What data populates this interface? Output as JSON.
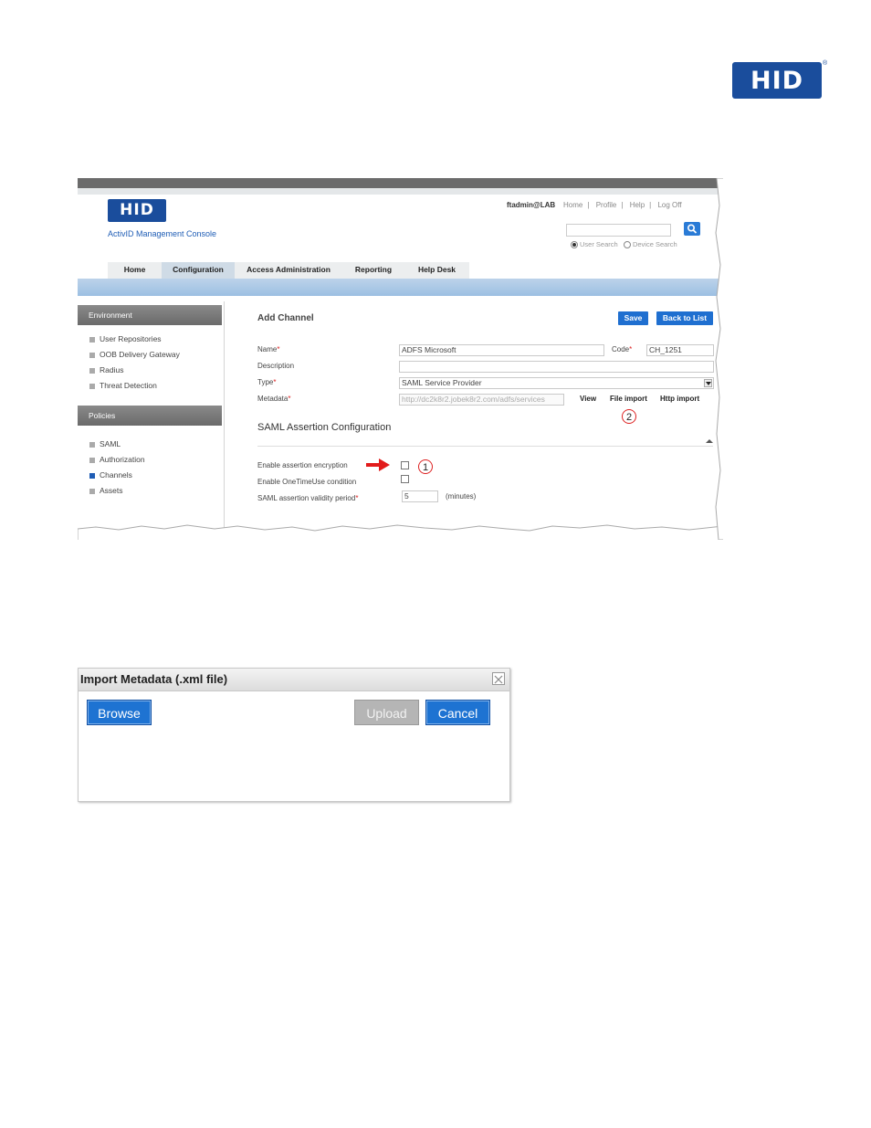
{
  "page_logo": {
    "text": "HID",
    "reg": "®"
  },
  "app": {
    "logo_text": "HID",
    "name": "ActivID Management Console",
    "user": "ftadmin@LAB",
    "user_links": [
      "Home",
      "Profile",
      "Help",
      "Log Off"
    ],
    "radio_user": "User Search",
    "radio_device": "Device Search"
  },
  "nav": {
    "tabs": [
      "Home",
      "Configuration",
      "Access Administration",
      "Reporting",
      "Help Desk"
    ],
    "active": "Configuration"
  },
  "sidebar": {
    "env_title": "Environment",
    "env_items": [
      "User Repositories",
      "OOB Delivery Gateway",
      "Radius",
      "Threat Detection"
    ],
    "pol_title": "Policies",
    "pol_items": [
      "SAML",
      "Authorization",
      "Channels",
      "Assets"
    ],
    "active_item": "Channels"
  },
  "form": {
    "title": "Add Channel",
    "save": "Save",
    "back": "Back to List",
    "name_label": "Name",
    "name_value": "ADFS Microsoft",
    "code_label": "Code",
    "code_value": "CH_1251",
    "desc_label": "Description",
    "type_label": "Type",
    "type_value": "SAML Service Provider",
    "meta_label": "Metadata",
    "meta_value": "http://dc2k8r2.jobek8r2.com/adfs/services",
    "view": "View",
    "file_import": "File import",
    "http_import": "Http import",
    "saml_title": "SAML Assertion Configuration",
    "enc_label": "Enable assertion encryption",
    "once_label": "Enable OneTimeUse condition",
    "validity_label": "SAML assertion validity period",
    "validity_value": "5",
    "minutes": "(minutes)",
    "required_mark": "*",
    "callout1": "1",
    "callout2": "2"
  },
  "dialog": {
    "title": "Import Metadata (.xml file)",
    "browse": "Browse",
    "upload": "Upload",
    "cancel": "Cancel"
  },
  "colors": {
    "brand": "#1a4d9c",
    "button_blue": "#1f6fd0",
    "callout_red": "#dd2222"
  }
}
